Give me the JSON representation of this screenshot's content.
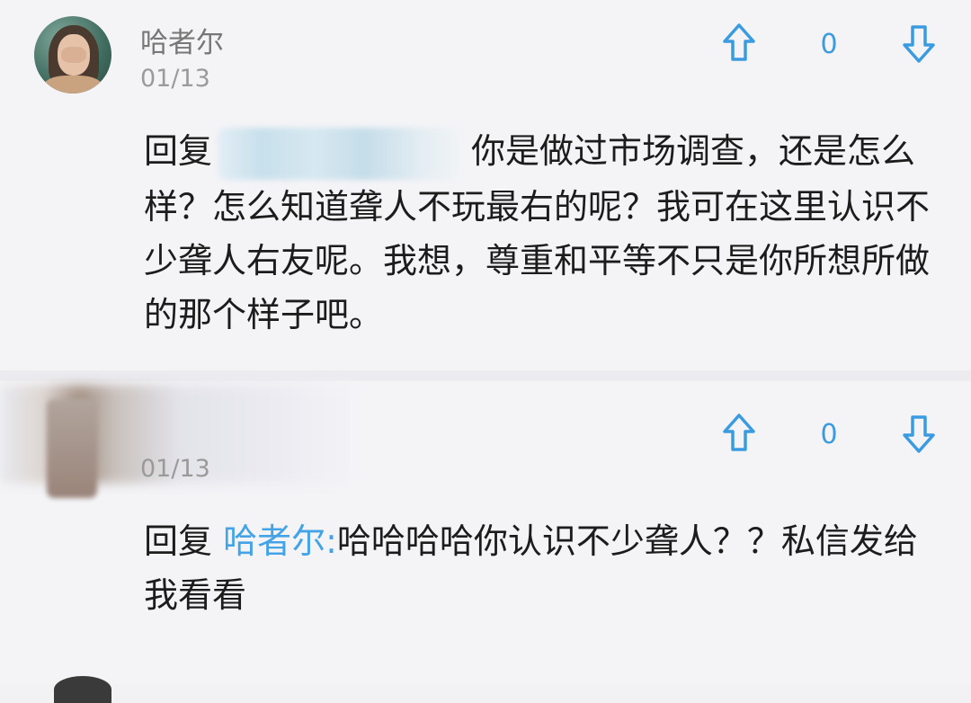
{
  "comments": [
    {
      "author": "哈者尔",
      "date": "01/13",
      "vote_count": "0",
      "reply_prefix": "回复",
      "text": "你是做过市场调查，还是怎么样？怎么知道聋人不玩最右的呢？我可在这里认识不少聋人右友呢。我想，尊重和平等不只是你所想所做的那个样子吧。"
    },
    {
      "author": "",
      "date": "01/13",
      "vote_count": "0",
      "reply_prefix": "回复",
      "mention": "哈者尔:",
      "text": "哈哈哈哈你认识不少聋人？？私信发给我看看"
    }
  ],
  "colors": {
    "vote_accent": "#3b9be0",
    "mention": "#43a3e6",
    "meta_gray": "#9a9a9a"
  },
  "icons": {
    "upvote": "upvote-arrow-icon",
    "downvote": "downvote-arrow-icon"
  }
}
